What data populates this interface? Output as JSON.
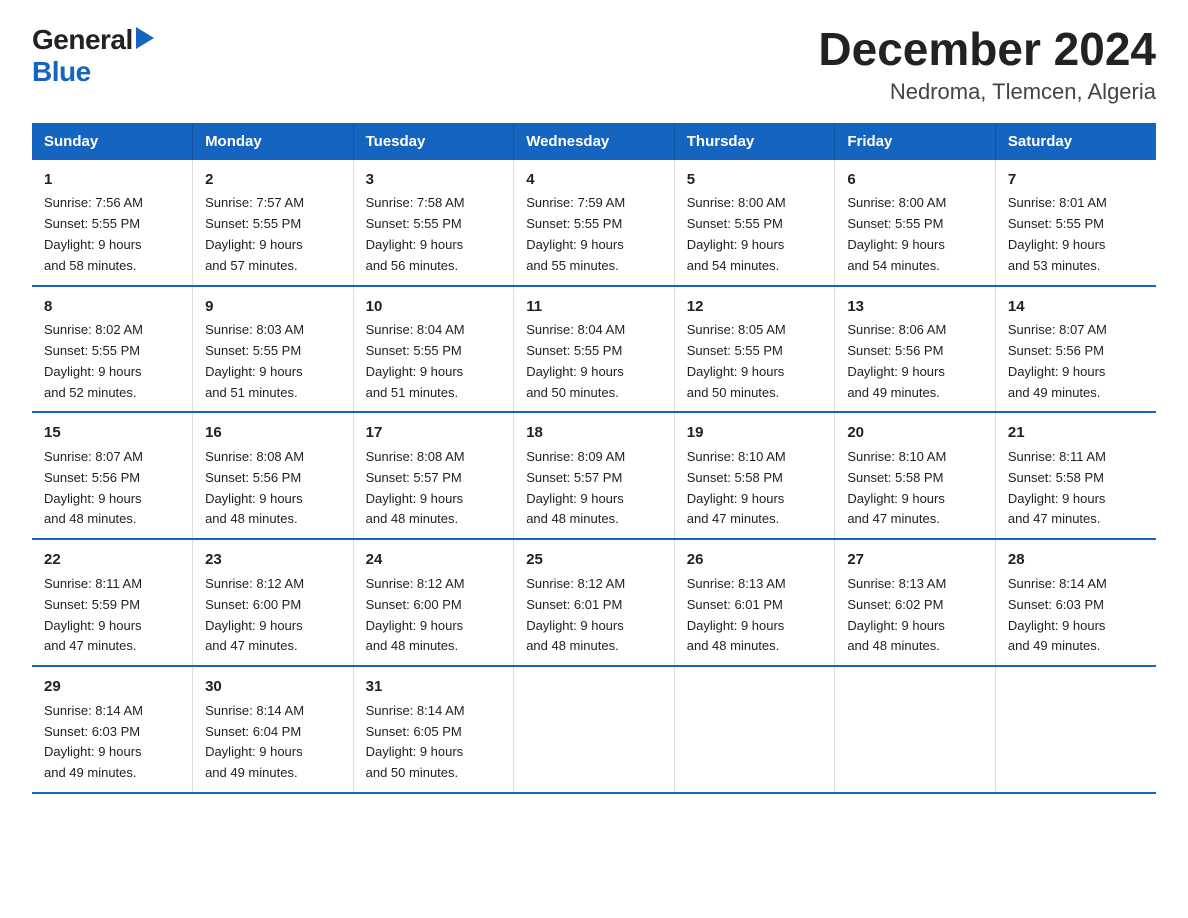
{
  "logo": {
    "general": "General",
    "blue": "Blue"
  },
  "title": "December 2024",
  "subtitle": "Nedroma, Tlemcen, Algeria",
  "days_of_week": [
    "Sunday",
    "Monday",
    "Tuesday",
    "Wednesday",
    "Thursday",
    "Friday",
    "Saturday"
  ],
  "weeks": [
    [
      {
        "day": "1",
        "sunrise": "7:56 AM",
        "sunset": "5:55 PM",
        "daylight": "9 hours and 58 minutes."
      },
      {
        "day": "2",
        "sunrise": "7:57 AM",
        "sunset": "5:55 PM",
        "daylight": "9 hours and 57 minutes."
      },
      {
        "day": "3",
        "sunrise": "7:58 AM",
        "sunset": "5:55 PM",
        "daylight": "9 hours and 56 minutes."
      },
      {
        "day": "4",
        "sunrise": "7:59 AM",
        "sunset": "5:55 PM",
        "daylight": "9 hours and 55 minutes."
      },
      {
        "day": "5",
        "sunrise": "8:00 AM",
        "sunset": "5:55 PM",
        "daylight": "9 hours and 54 minutes."
      },
      {
        "day": "6",
        "sunrise": "8:00 AM",
        "sunset": "5:55 PM",
        "daylight": "9 hours and 54 minutes."
      },
      {
        "day": "7",
        "sunrise": "8:01 AM",
        "sunset": "5:55 PM",
        "daylight": "9 hours and 53 minutes."
      }
    ],
    [
      {
        "day": "8",
        "sunrise": "8:02 AM",
        "sunset": "5:55 PM",
        "daylight": "9 hours and 52 minutes."
      },
      {
        "day": "9",
        "sunrise": "8:03 AM",
        "sunset": "5:55 PM",
        "daylight": "9 hours and 51 minutes."
      },
      {
        "day": "10",
        "sunrise": "8:04 AM",
        "sunset": "5:55 PM",
        "daylight": "9 hours and 51 minutes."
      },
      {
        "day": "11",
        "sunrise": "8:04 AM",
        "sunset": "5:55 PM",
        "daylight": "9 hours and 50 minutes."
      },
      {
        "day": "12",
        "sunrise": "8:05 AM",
        "sunset": "5:55 PM",
        "daylight": "9 hours and 50 minutes."
      },
      {
        "day": "13",
        "sunrise": "8:06 AM",
        "sunset": "5:56 PM",
        "daylight": "9 hours and 49 minutes."
      },
      {
        "day": "14",
        "sunrise": "8:07 AM",
        "sunset": "5:56 PM",
        "daylight": "9 hours and 49 minutes."
      }
    ],
    [
      {
        "day": "15",
        "sunrise": "8:07 AM",
        "sunset": "5:56 PM",
        "daylight": "9 hours and 48 minutes."
      },
      {
        "day": "16",
        "sunrise": "8:08 AM",
        "sunset": "5:56 PM",
        "daylight": "9 hours and 48 minutes."
      },
      {
        "day": "17",
        "sunrise": "8:08 AM",
        "sunset": "5:57 PM",
        "daylight": "9 hours and 48 minutes."
      },
      {
        "day": "18",
        "sunrise": "8:09 AM",
        "sunset": "5:57 PM",
        "daylight": "9 hours and 48 minutes."
      },
      {
        "day": "19",
        "sunrise": "8:10 AM",
        "sunset": "5:58 PM",
        "daylight": "9 hours and 47 minutes."
      },
      {
        "day": "20",
        "sunrise": "8:10 AM",
        "sunset": "5:58 PM",
        "daylight": "9 hours and 47 minutes."
      },
      {
        "day": "21",
        "sunrise": "8:11 AM",
        "sunset": "5:58 PM",
        "daylight": "9 hours and 47 minutes."
      }
    ],
    [
      {
        "day": "22",
        "sunrise": "8:11 AM",
        "sunset": "5:59 PM",
        "daylight": "9 hours and 47 minutes."
      },
      {
        "day": "23",
        "sunrise": "8:12 AM",
        "sunset": "6:00 PM",
        "daylight": "9 hours and 47 minutes."
      },
      {
        "day": "24",
        "sunrise": "8:12 AM",
        "sunset": "6:00 PM",
        "daylight": "9 hours and 48 minutes."
      },
      {
        "day": "25",
        "sunrise": "8:12 AM",
        "sunset": "6:01 PM",
        "daylight": "9 hours and 48 minutes."
      },
      {
        "day": "26",
        "sunrise": "8:13 AM",
        "sunset": "6:01 PM",
        "daylight": "9 hours and 48 minutes."
      },
      {
        "day": "27",
        "sunrise": "8:13 AM",
        "sunset": "6:02 PM",
        "daylight": "9 hours and 48 minutes."
      },
      {
        "day": "28",
        "sunrise": "8:14 AM",
        "sunset": "6:03 PM",
        "daylight": "9 hours and 49 minutes."
      }
    ],
    [
      {
        "day": "29",
        "sunrise": "8:14 AM",
        "sunset": "6:03 PM",
        "daylight": "9 hours and 49 minutes."
      },
      {
        "day": "30",
        "sunrise": "8:14 AM",
        "sunset": "6:04 PM",
        "daylight": "9 hours and 49 minutes."
      },
      {
        "day": "31",
        "sunrise": "8:14 AM",
        "sunset": "6:05 PM",
        "daylight": "9 hours and 50 minutes."
      },
      null,
      null,
      null,
      null
    ]
  ],
  "labels": {
    "sunrise": "Sunrise:",
    "sunset": "Sunset:",
    "daylight": "Daylight:"
  }
}
